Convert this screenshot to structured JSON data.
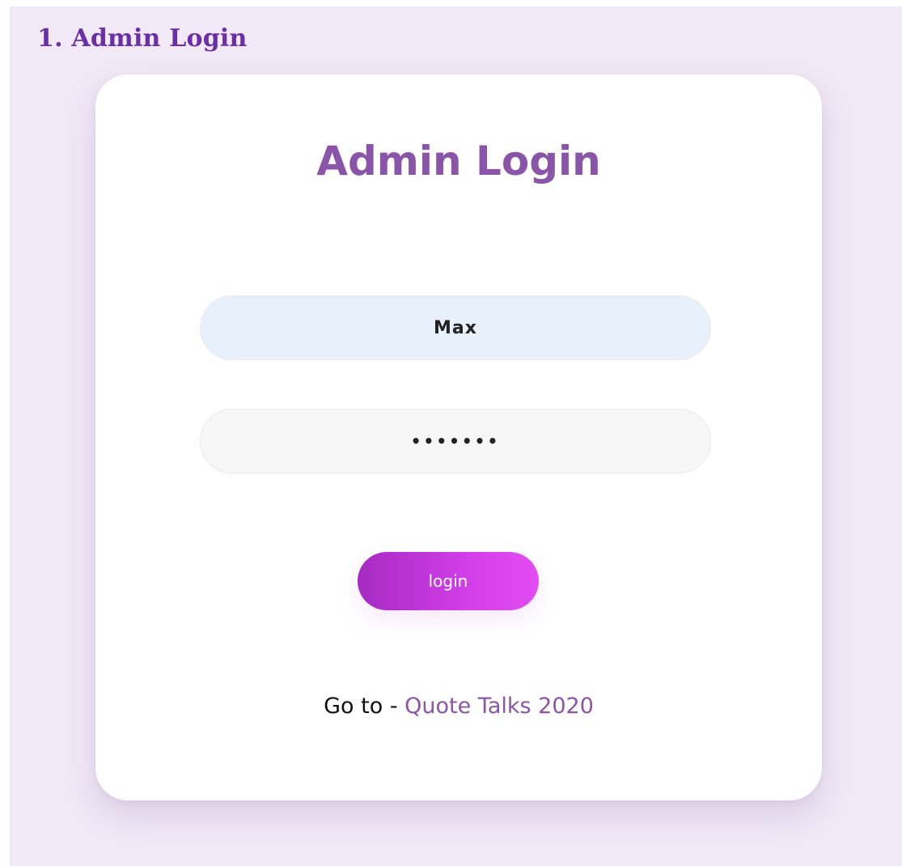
{
  "section": {
    "heading": "1. Admin Login"
  },
  "card": {
    "title": "Admin Login",
    "username": {
      "value": "Max"
    },
    "password": {
      "value": "•••••••"
    },
    "login_button_label": "login",
    "footer": {
      "prefix": "Go to - ",
      "link_text": "Quote Talks 2020"
    }
  },
  "colors": {
    "heading": "#6a2fa8",
    "card_title": "#8a55a8",
    "link": "#8a55a8",
    "button_gradient_start": "#a52ac2",
    "button_gradient_end": "#e24cf2",
    "page_background": "#f1e9f6",
    "username_field_background": "#e8f0fc"
  }
}
